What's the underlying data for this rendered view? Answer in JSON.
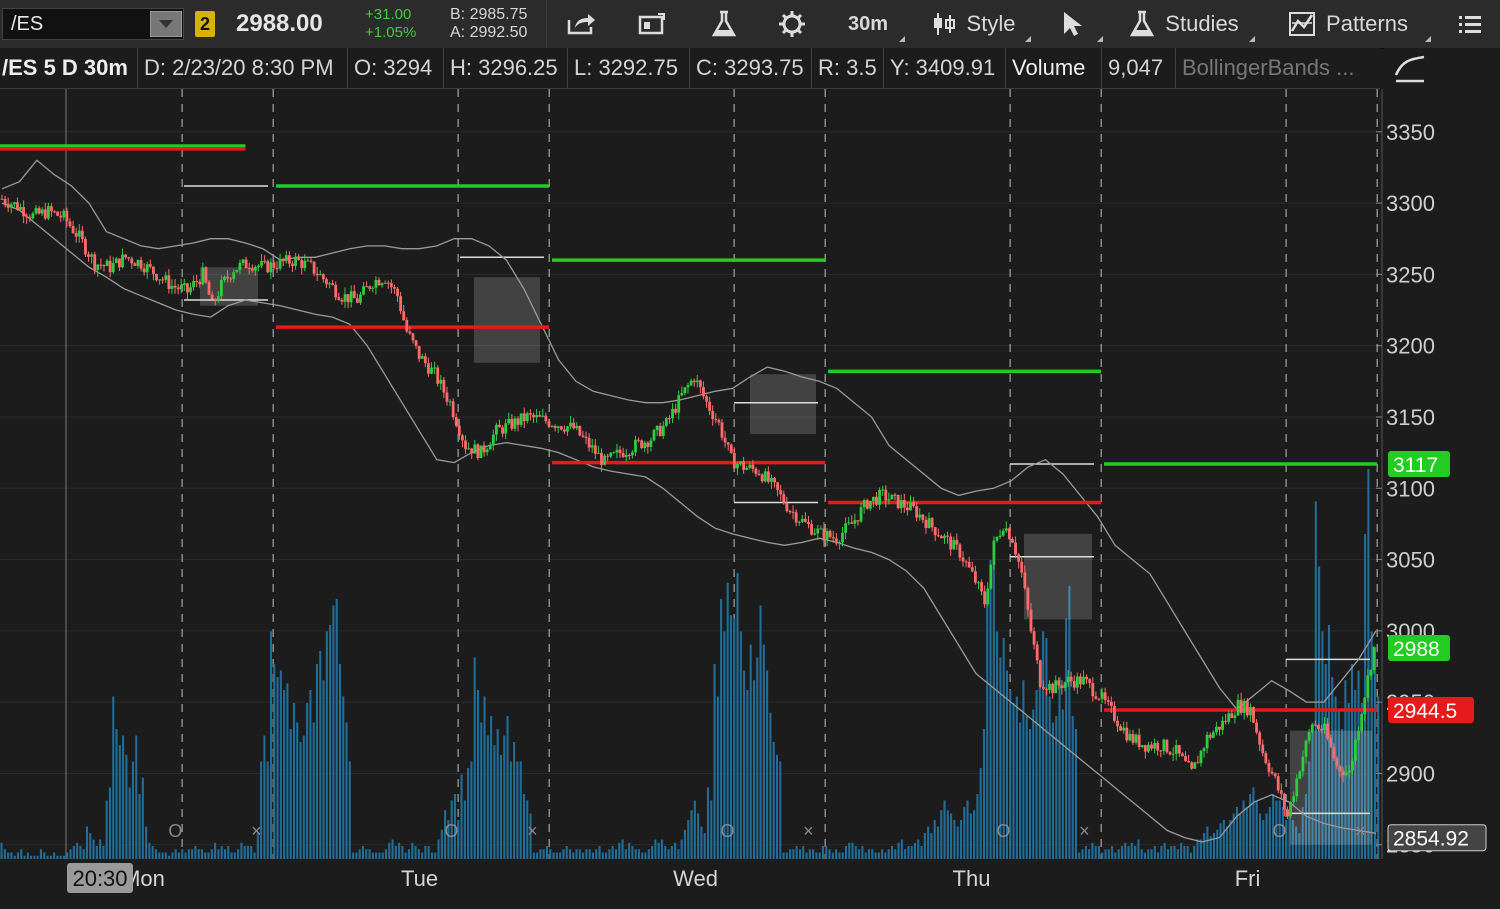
{
  "toolbar": {
    "symbol": "/ES",
    "link_badge": "2",
    "last_price": "2988.00",
    "change_abs": "+31.00",
    "change_pct": "+1.05%",
    "bid": "B: 2985.75",
    "ask": "A: 2992.50",
    "timeframe_label": "30m",
    "style_label": "Style",
    "studies_label": "Studies",
    "patterns_label": "Patterns",
    "icons": [
      "share-icon",
      "quote-icon",
      "flask-icon",
      "gear-icon",
      "candle-icon",
      "cursor-icon",
      "flask-icon",
      "patterns-icon",
      "menu-icon"
    ]
  },
  "infobar": {
    "title": "/ES 5 D 30m",
    "date": "D: 2/23/20 8:30 PM",
    "open": "O: 3294",
    "high": "H: 3296.25",
    "low": "L: 3292.75",
    "close": "C: 3293.75",
    "range": "R: 3.5",
    "y": "Y: 3409.91",
    "volume_label": "Volume",
    "volume_value": "9,047",
    "study_label": "BollingerBands ..."
  },
  "chart_data": {
    "type": "candlestick",
    "symbol": "/ES",
    "aggregation": "30m",
    "x_labels": [
      "Mon",
      "Tue",
      "Wed",
      "Thu",
      "Fri"
    ],
    "crosshair_time": "20:30",
    "ylim": [
      2840,
      3380
    ],
    "y_ticks": [
      3350,
      3300,
      3250,
      3200,
      3150,
      3100,
      3050,
      3000,
      2950,
      2900,
      2850
    ],
    "price_badges": [
      {
        "label": "3117",
        "value": 3117,
        "color": "#22cc22"
      },
      {
        "label": "2988",
        "value": 2988,
        "color": "#22cc22"
      },
      {
        "label": "2944.5",
        "value": 2944.5,
        "color": "#e61a1a"
      },
      {
        "label": "2854.92",
        "value": 2854.92,
        "color": "#444444"
      }
    ],
    "grid": true,
    "session_lines_dashed": true,
    "series": [
      {
        "name": "Price",
        "points": [
          [
            0,
            3303
          ],
          [
            5,
            3298
          ],
          [
            10,
            3291
          ],
          [
            15,
            3294
          ],
          [
            20,
            3290
          ],
          [
            25,
            3276
          ],
          [
            30,
            3258
          ],
          [
            35,
            3255
          ],
          [
            40,
            3262
          ],
          [
            45,
            3258
          ],
          [
            50,
            3250
          ],
          [
            55,
            3242
          ],
          [
            60,
            3238
          ],
          [
            65,
            3250
          ],
          [
            68,
            3228
          ],
          [
            71,
            3242
          ],
          [
            75,
            3254
          ],
          [
            80,
            3258
          ],
          [
            85,
            3255
          ],
          [
            90,
            3258
          ],
          [
            95,
            3260
          ],
          [
            100,
            3255
          ],
          [
            105,
            3245
          ],
          [
            110,
            3235
          ],
          [
            115,
            3232
          ],
          [
            120,
            3245
          ],
          [
            124,
            3248
          ],
          [
            128,
            3235
          ],
          [
            131,
            3210
          ],
          [
            135,
            3193
          ],
          [
            140,
            3180
          ],
          [
            145,
            3160
          ],
          [
            150,
            3130
          ],
          [
            155,
            3125
          ],
          [
            160,
            3140
          ],
          [
            165,
            3145
          ],
          [
            170,
            3150
          ],
          [
            175,
            3148
          ],
          [
            180,
            3145
          ],
          [
            185,
            3142
          ],
          [
            190,
            3130
          ],
          [
            195,
            3118
          ],
          [
            200,
            3125
          ],
          [
            205,
            3130
          ],
          [
            210,
            3135
          ],
          [
            215,
            3145
          ],
          [
            220,
            3165
          ],
          [
            224,
            3178
          ],
          [
            228,
            3160
          ],
          [
            232,
            3145
          ],
          [
            236,
            3120
          ],
          [
            240,
            3115
          ],
          [
            245,
            3112
          ],
          [
            250,
            3100
          ],
          [
            255,
            3085
          ],
          [
            260,
            3075
          ],
          [
            265,
            3068
          ],
          [
            270,
            3065
          ],
          [
            275,
            3075
          ],
          [
            280,
            3090
          ],
          [
            285,
            3095
          ],
          [
            290,
            3090
          ],
          [
            295,
            3085
          ],
          [
            300,
            3075
          ],
          [
            305,
            3065
          ],
          [
            310,
            3055
          ],
          [
            315,
            3035
          ],
          [
            318,
            3020
          ],
          [
            321,
            3060
          ],
          [
            324,
            3075
          ],
          [
            327,
            3065
          ],
          [
            330,
            3040
          ],
          [
            333,
            3000
          ],
          [
            336,
            2965
          ],
          [
            340,
            2960
          ],
          [
            345,
            2965
          ],
          [
            350,
            2965
          ],
          [
            355,
            2955
          ],
          [
            360,
            2940
          ],
          [
            365,
            2925
          ],
          [
            370,
            2920
          ],
          [
            375,
            2920
          ],
          [
            380,
            2915
          ],
          [
            385,
            2900
          ],
          [
            390,
            2925
          ],
          [
            395,
            2935
          ],
          [
            400,
            2948
          ],
          [
            404,
            2945
          ],
          [
            408,
            2915
          ],
          [
            412,
            2895
          ],
          [
            416,
            2870
          ],
          [
            420,
            2905
          ],
          [
            424,
            2935
          ],
          [
            428,
            2930
          ],
          [
            432,
            2905
          ],
          [
            436,
            2900
          ],
          [
            440,
            2945
          ],
          [
            444,
            2988
          ]
        ]
      },
      {
        "name": "Volume",
        "values": [
          5,
          3,
          2,
          2,
          1,
          2,
          3,
          1,
          2,
          1,
          1,
          1,
          3,
          2,
          1,
          1,
          2,
          1,
          1,
          1,
          2,
          3,
          4,
          5,
          4,
          3,
          10,
          8,
          6,
          4,
          6,
          4,
          18,
          22,
          50,
          40,
          35,
          38,
          32,
          22,
          30,
          38,
          20,
          25,
          10,
          5,
          4,
          3,
          2,
          2,
          2,
          1,
          2,
          3,
          2,
          3,
          2,
          3,
          3,
          4,
          3,
          3,
          2,
          2,
          3,
          5,
          3,
          4,
          3,
          4,
          2,
          2,
          3,
          5,
          4,
          4,
          4,
          2,
          8,
          30,
          38,
          30,
          70,
          60,
          56,
          58,
          52,
          54,
          40,
          48,
          42,
          36,
          38,
          48,
          52,
          42,
          60,
          64,
          55,
          70,
          72,
          78,
          80,
          60,
          50,
          42,
          30,
          2,
          2,
          3,
          4,
          3,
          3,
          2,
          2,
          2,
          2,
          3,
          5,
          6,
          4,
          5,
          4,
          2,
          3,
          5,
          4,
          3,
          2,
          4,
          4,
          2,
          2,
          6,
          9,
          15,
          12,
          18,
          20,
          12,
          26,
          18,
          28,
          30,
          62,
          52,
          42,
          50,
          38,
          44,
          35,
          40,
          32,
          38,
          44,
          30,
          36,
          30,
          30,
          20,
          18,
          14,
          2,
          2,
          3,
          3,
          4,
          3,
          2,
          2,
          2,
          3,
          4,
          3,
          2,
          3,
          3,
          2,
          3,
          3,
          2,
          3,
          4,
          2,
          2,
          3,
          4,
          3,
          5,
          6,
          3,
          5,
          4,
          3,
          3,
          2,
          2,
          3,
          4,
          6,
          5,
          6,
          4,
          3,
          4,
          5,
          3,
          6,
          9,
          12,
          15,
          18,
          14,
          10,
          8,
          22,
          18,
          60,
          50,
          80,
          70,
          85,
          75,
          74,
          88,
          70,
          58,
          52,
          66,
          55,
          62,
          78,
          66,
          58,
          45,
          36,
          32,
          30,
          2,
          2,
          3,
          3,
          4,
          3,
          4,
          2,
          3,
          3,
          2,
          2,
          4,
          4,
          3,
          2,
          3,
          2,
          2,
          4,
          5,
          5,
          4,
          3,
          4,
          2,
          3,
          3,
          2,
          2,
          3,
          2,
          3,
          4,
          3,
          5,
          6,
          3,
          4,
          4,
          5,
          6,
          4,
          8,
          10,
          8,
          12,
          10,
          15,
          18,
          15,
          14,
          12,
          10,
          12,
          16,
          18,
          14,
          15,
          20,
          28,
          40,
          80,
          92,
          95,
          70,
          62,
          68,
          58,
          52,
          48,
          50,
          42,
          55,
          44,
          40,
          46,
          52,
          60,
          70,
          68,
          50,
          42,
          44,
          56,
          46,
          74,
          84,
          44,
          40,
          2,
          3,
          4,
          3,
          5,
          4,
          4,
          2,
          3,
          3,
          4,
          2,
          3,
          4,
          5,
          4,
          5,
          4,
          6,
          3,
          2,
          3,
          3,
          4,
          2,
          4,
          5,
          3,
          4,
          4,
          3,
          5,
          4,
          4,
          2,
          4,
          6,
          6,
          8,
          10,
          7,
          8,
          9,
          11,
          12,
          10,
          12,
          14,
          16,
          14,
          18,
          16,
          20,
          22,
          18,
          14,
          12,
          14,
          16,
          20,
          18,
          18,
          16,
          12,
          14,
          12,
          10,
          8,
          16,
          20,
          30,
          42,
          110,
          90,
          70,
          60,
          72,
          56,
          50,
          46,
          40,
          55,
          48,
          60,
          52,
          58,
          48,
          100,
          120,
          70,
          65,
          50
        ]
      },
      {
        "name": "BollingerBands",
        "upper": [
          3310,
          3315,
          3330,
          3320,
          3312,
          3300,
          3280,
          3275,
          3270,
          3268,
          3270,
          3272,
          3275,
          3275,
          3272,
          3268,
          3260,
          3262,
          3262,
          3265,
          3268,
          3270,
          3270,
          3268,
          3268,
          3270,
          3275,
          3275,
          3270,
          3260,
          3240,
          3215,
          3190,
          3175,
          3168,
          3165,
          3162,
          3160,
          3160,
          3162,
          3165,
          3168,
          3170,
          3178,
          3185,
          3182,
          3178,
          3175,
          3170,
          3160,
          3150,
          3130,
          3120,
          3110,
          3100,
          3095,
          3098,
          3100,
          3105,
          3115,
          3120,
          3110,
          3095,
          3080,
          3060,
          3050,
          3040,
          3020,
          3000,
          2980,
          2960,
          2945,
          2955,
          2965,
          2958,
          2950,
          2950,
          2965,
          2980,
          3000
        ],
        "lower": [
          3300,
          3295,
          3285,
          3275,
          3265,
          3255,
          3248,
          3240,
          3235,
          3230,
          3225,
          3222,
          3220,
          3228,
          3232,
          3230,
          3228,
          3225,
          3222,
          3220,
          3215,
          3200,
          3180,
          3160,
          3140,
          3120,
          3118,
          3125,
          3130,
          3132,
          3130,
          3128,
          3125,
          3120,
          3115,
          3112,
          3110,
          3108,
          3100,
          3090,
          3080,
          3072,
          3068,
          3065,
          3062,
          3060,
          3062,
          3065,
          3062,
          3058,
          3055,
          3050,
          3042,
          3030,
          3010,
          2990,
          2970,
          2960,
          2950,
          2940,
          2930,
          2920,
          2910,
          2900,
          2890,
          2880,
          2870,
          2860,
          2855,
          2852,
          2855,
          2870,
          2880,
          2885,
          2880,
          2870,
          2865,
          2862,
          2860,
          2858
        ]
      }
    ],
    "levels": [
      {
        "kind": "prior-high",
        "value": 3340,
        "from": 0,
        "to": 0.18,
        "color": "#22cc22"
      },
      {
        "kind": "prior-low",
        "value": 3338,
        "from": 0,
        "to": 0.18,
        "color": "#e61a1a"
      },
      {
        "kind": "prior-high",
        "value": 3312,
        "from": 0.2,
        "to": 0.4,
        "color": "#22cc22"
      },
      {
        "kind": "prior-low",
        "value": 3213,
        "from": 0.2,
        "to": 0.4,
        "color": "#e61a1a"
      },
      {
        "kind": "prior-high",
        "value": 3260,
        "from": 0.4,
        "to": 0.6,
        "color": "#22cc22"
      },
      {
        "kind": "prior-low",
        "value": 3118,
        "from": 0.4,
        "to": 0.6,
        "color": "#e61a1a"
      },
      {
        "kind": "prior-high",
        "value": 3182,
        "from": 0.6,
        "to": 0.8,
        "color": "#22cc22"
      },
      {
        "kind": "prior-low",
        "value": 3090,
        "from": 0.6,
        "to": 0.8,
        "color": "#e61a1a"
      },
      {
        "kind": "prior-high",
        "value": 3117,
        "from": 0.8,
        "to": 1.0,
        "color": "#22cc22"
      },
      {
        "kind": "prior-low",
        "value": 2944.5,
        "from": 0.8,
        "to": 1.0,
        "color": "#e61a1a"
      }
    ]
  }
}
